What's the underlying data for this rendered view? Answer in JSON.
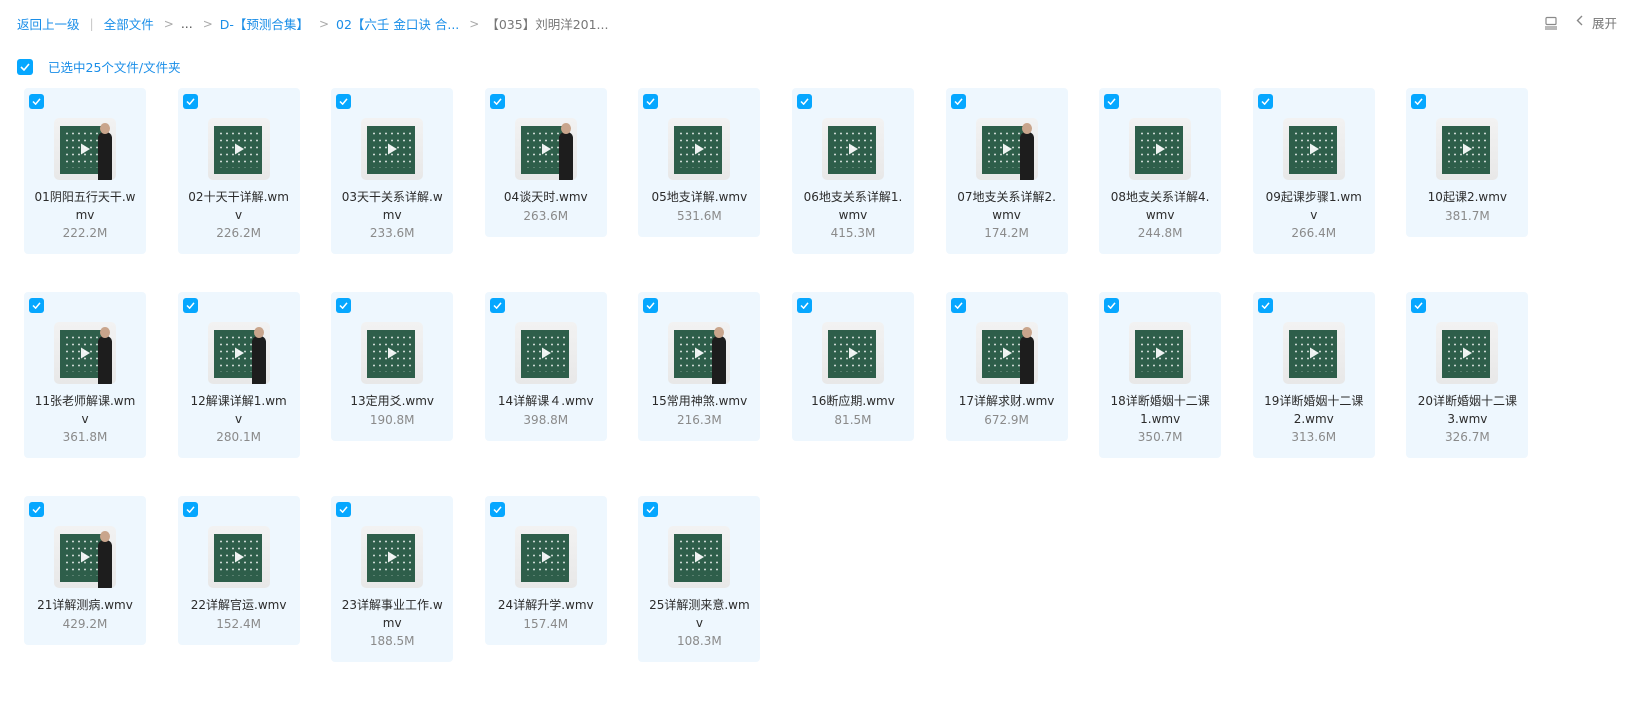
{
  "breadcrumb": {
    "back": "返回上一级",
    "all_files": "全部文件",
    "ellipsis": "...",
    "folder1": "D-【预测合集】",
    "folder2": "02【六壬 金口诀 合...",
    "current": "【035】刘明洋201..."
  },
  "toolbar": {
    "expand_label": "展开",
    "view_icon": "list-view-icon",
    "expand_icon": "chevron-left-icon"
  },
  "selection": {
    "text": "已选中25个文件/文件夹"
  },
  "colors": {
    "accent": "#06a7ff",
    "link": "#1a8ee8",
    "card_bg": "#eef7fe"
  },
  "files": [
    {
      "name": "01阴阳五行天干.wmv",
      "size": "222.2M"
    },
    {
      "name": "02十天干详解.wmv",
      "size": "226.2M"
    },
    {
      "name": "03天干关系详解.wmv",
      "size": "233.6M"
    },
    {
      "name": "04谈天时.wmv",
      "size": "263.6M"
    },
    {
      "name": "05地支详解.wmv",
      "size": "531.6M"
    },
    {
      "name": "06地支关系详解1.wmv",
      "size": "415.3M"
    },
    {
      "name": "07地支关系详解2.wmv",
      "size": "174.2M"
    },
    {
      "name": "08地支关系详解4.wmv",
      "size": "244.8M"
    },
    {
      "name": "09起课步骤1.wmv",
      "size": "266.4M"
    },
    {
      "name": "10起课2.wmv",
      "size": "381.7M"
    },
    {
      "name": "11张老师解课.wmv",
      "size": "361.8M"
    },
    {
      "name": "12解课详解1.wmv",
      "size": "280.1M"
    },
    {
      "name": "13定用爻.wmv",
      "size": "190.8M"
    },
    {
      "name": "14详解课４.wmv",
      "size": "398.8M"
    },
    {
      "name": "15常用神煞.wmv",
      "size": "216.3M"
    },
    {
      "name": "16断应期.wmv",
      "size": "81.5M"
    },
    {
      "name": "17详解求财.wmv",
      "size": "672.9M"
    },
    {
      "name": "18详断婚姻十二课1.wmv",
      "size": "350.7M"
    },
    {
      "name": "19详断婚姻十二课2.wmv",
      "size": "313.6M"
    },
    {
      "name": "20详断婚姻十二课3.wmv",
      "size": "326.7M"
    },
    {
      "name": "21详解测病.wmv",
      "size": "429.2M"
    },
    {
      "name": "22详解官运.wmv",
      "size": "152.4M"
    },
    {
      "name": "23详解事业工作.wmv",
      "size": "188.5M"
    },
    {
      "name": "24详解升学.wmv",
      "size": "157.4M"
    },
    {
      "name": "25详解测来意.wmv",
      "size": "108.3M"
    }
  ]
}
